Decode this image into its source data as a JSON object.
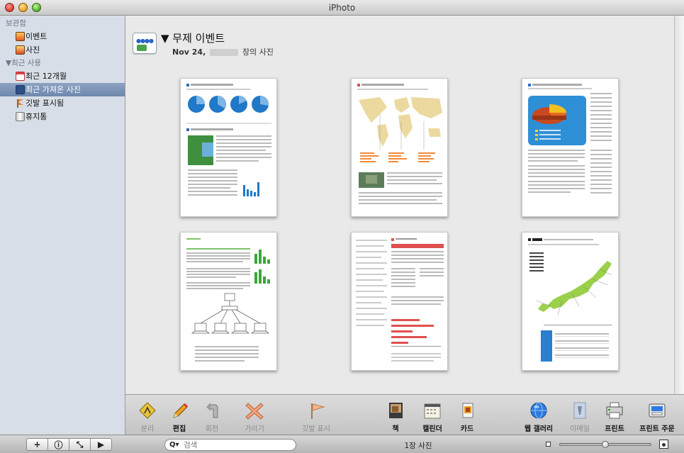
{
  "window": {
    "title": "iPhoto"
  },
  "sidebar": {
    "library_header": "보관함",
    "library_items": [
      {
        "label": "이벤트",
        "icon": "events-icon"
      },
      {
        "label": "사진",
        "icon": "photos-icon"
      }
    ],
    "recent_header": "▼최근 사용",
    "recent_items": [
      {
        "label": "최근 12개월",
        "icon": "calendar-icon"
      },
      {
        "label": "최근 가져온 사진",
        "icon": "import-icon",
        "selected": true
      },
      {
        "label": "깃발 표시됨",
        "icon": "flag-icon"
      },
      {
        "label": "휴지통",
        "icon": "trash-icon"
      }
    ]
  },
  "event": {
    "title": "▼ 무제 이벤트",
    "date": "Nov 24,",
    "count_suffix": "장의 사진"
  },
  "toolbar": {
    "items": [
      {
        "label": "분리",
        "icon": "split-icon",
        "enabled": false
      },
      {
        "label": "편집",
        "icon": "pencil-icon",
        "enabled": true
      },
      {
        "label": "회전",
        "icon": "rotate-icon",
        "enabled": false
      },
      {
        "label": "가리기",
        "icon": "hide-icon",
        "enabled": false
      },
      {
        "label": "깃발 표시",
        "icon": "flag-icon",
        "enabled": false
      },
      {
        "label": "책",
        "icon": "book-icon",
        "enabled": true
      },
      {
        "label": "캘린더",
        "icon": "calendar-icon",
        "enabled": true
      },
      {
        "label": "카드",
        "icon": "card-icon",
        "enabled": true
      },
      {
        "label": "웹 갤러리",
        "icon": "globe-icon",
        "enabled": true
      },
      {
        "label": "이메일",
        "icon": "email-icon",
        "enabled": false
      },
      {
        "label": "프린트",
        "icon": "printer-icon",
        "enabled": true
      },
      {
        "label": "프린트 주문",
        "icon": "print-order-icon",
        "enabled": true
      }
    ]
  },
  "statusbar": {
    "buttons": [
      {
        "glyph": "+",
        "name": "add-icon"
      },
      {
        "glyph": "ⓘ",
        "name": "info-icon"
      },
      {
        "glyph": "⤡",
        "name": "fullscreen-icon"
      },
      {
        "glyph": "▶",
        "name": "play-icon"
      }
    ],
    "search_prefix": "Q▾",
    "search_placeholder": "검색",
    "photo_count": "1장 사진",
    "zoom_level": 0.5
  }
}
